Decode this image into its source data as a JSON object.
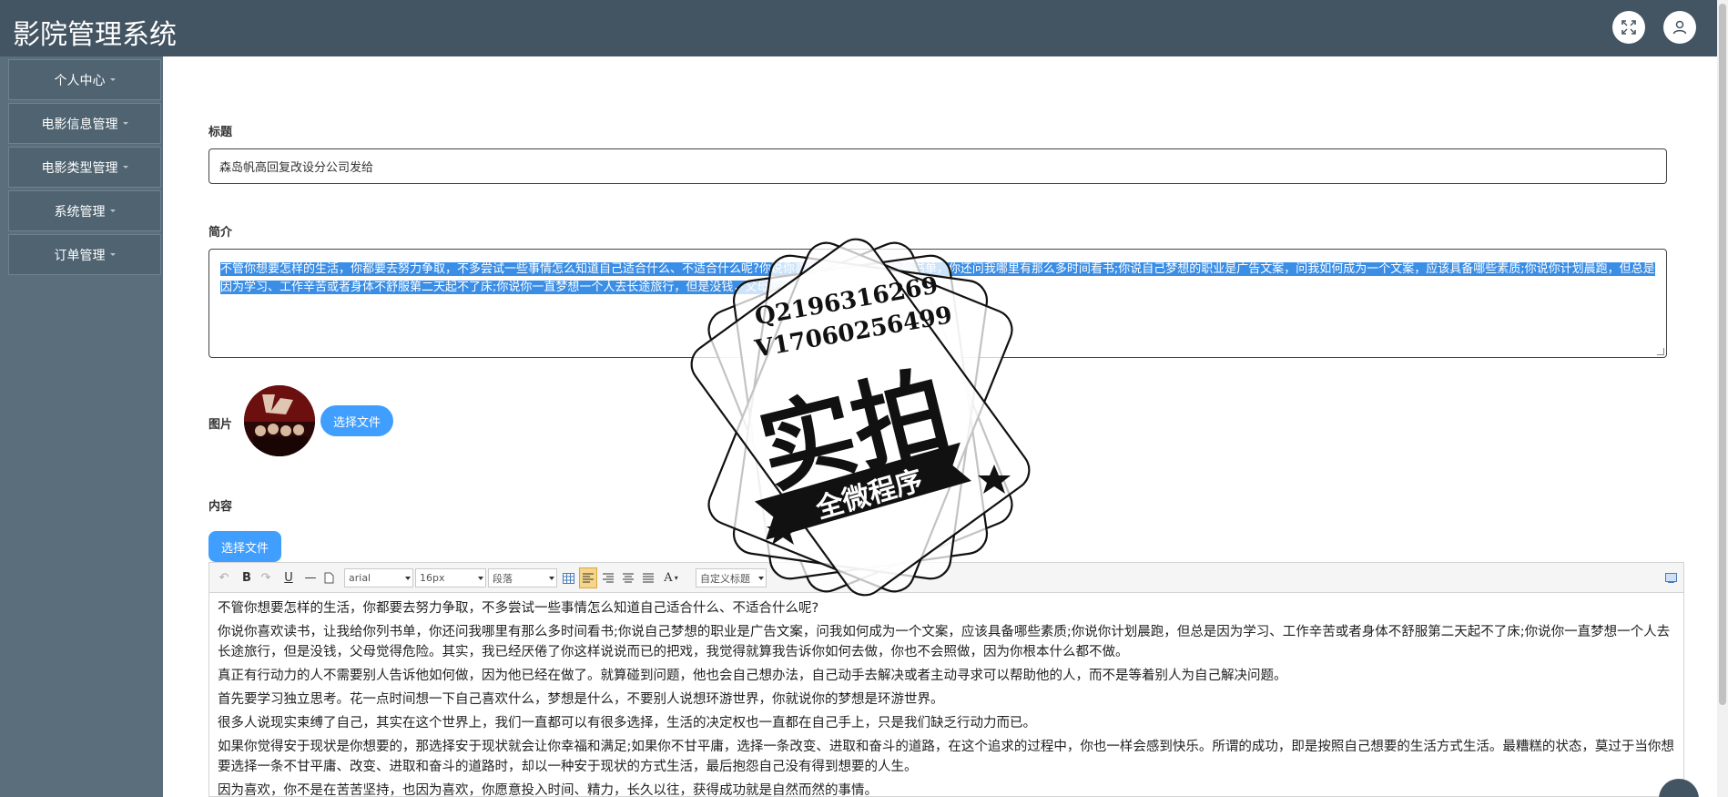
{
  "app": {
    "title": "影院管理系统"
  },
  "header": {
    "fullscreen_icon": "fullscreen-icon",
    "avatar_icon": "user-icon"
  },
  "sidebar": {
    "items": [
      {
        "label": "个人中心"
      },
      {
        "label": "电影信息管理"
      },
      {
        "label": "电影类型管理"
      },
      {
        "label": "系统管理"
      },
      {
        "label": "订单管理"
      }
    ]
  },
  "form": {
    "title_label": "标题",
    "title_value": "森岛帆高回复改设分公司发给",
    "summary_label": "简介",
    "summary_value": "不管你想要怎样的生活，你都要去努力争取，不多尝试一些事情怎么知道自己适合什么、不适合什么呢?你说你喜欢读书，让我给你列书单，你还问我哪里有那么多时间看书;你说自己梦想的职业是广告文案，问我如何成为一个文案，应该具备哪些素质;你说你计划晨跑，但总是因为学习、工作辛苦或者身体不舒服第二天起不了床;你说你一直梦想一个人去长途旅行，但是没钱，父母觉得危险。",
    "image_label": "图片",
    "choose_file_label": "选择文件",
    "content_label": "内容",
    "content_choose_file_label": "选择文件"
  },
  "editor": {
    "toolbar": {
      "bold": "B",
      "underline": "U",
      "font_family": "arial",
      "font_size": "16px",
      "paragraph": "段落",
      "font_color": "A",
      "custom_title": "自定义标题"
    },
    "paragraphs": [
      "不管你想要怎样的生活，你都要去努力争取，不多尝试一些事情怎么知道自己适合什么、不适合什么呢?",
      "你说你喜欢读书，让我给你列书单，你还问我哪里有那么多时间看书;你说自己梦想的职业是广告文案，问我如何成为一个文案，应该具备哪些素质;你说你计划晨跑，但总是因为学习、工作辛苦或者身体不舒服第二天起不了床;你说你一直梦想一个人去长途旅行，但是没钱，父母觉得危险。其实，我已经厌倦了你这样说说而已的把戏，我觉得就算我告诉你如何去做，你也不会照做，因为你根本什么都不做。",
      "真正有行动力的人不需要别人告诉他如何做，因为他已经在做了。就算碰到问题，他也会自己想办法，自己动手去解决或者主动寻求可以帮助他的人，而不是等着别人为自己解决问题。",
      "首先要学习独立思考。花一点时间想一下自己喜欢什么，梦想是什么，不要别人说想环游世界，你就说你的梦想是环游世界。",
      "很多人说现实束缚了自己，其实在这个世界上，我们一直都可以有很多选择，生活的决定权也一直都在自己手上，只是我们缺乏行动力而已。",
      "如果你觉得安于现状是你想要的，那选择安于现状就会让你幸福和满足;如果你不甘平庸，选择一条改变、进取和奋斗的道路，在这个追求的过程中，你也一样会感到快乐。所谓的成功，即是按照自己想要的生活方式生活。最糟糕的状态，莫过于当你想要选择一条不甘平庸、改变、进取和奋斗的道路时，却以一种安于现状的方式生活，最后抱怨自己没有得到想要的人生。",
      "因为喜欢，你不是在苦苦坚持，也因为喜欢，你愿意投入时间、精力，长久以往，获得成功就是自然而然的事情。"
    ]
  },
  "watermark": {
    "line1": "Q2196316269",
    "line2": "V17060256499",
    "main": "实拍",
    "ribbon": "全微程序"
  }
}
